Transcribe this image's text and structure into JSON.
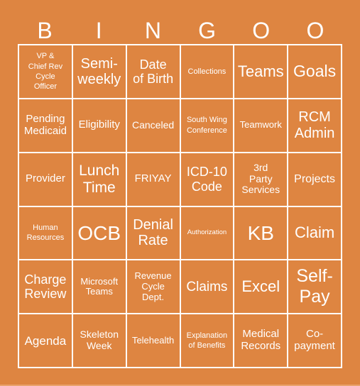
{
  "card": {
    "header_letters": [
      "B",
      "I",
      "N",
      "G",
      "O",
      "O"
    ],
    "colors": {
      "background": "#de8541",
      "grid_lines": "#ffffff",
      "text": "#ffffff"
    },
    "rows": [
      [
        "VP &\nChief Rev\nCycle\nOfficer",
        "Semi-\nweekly",
        "Date\nof Birth",
        "Collections",
        "Teams",
        "Goals"
      ],
      [
        "Pending\nMedicaid",
        "Eligibility",
        "Canceled",
        "South Wing\nConference",
        "Teamwork",
        "RCM\nAdmin"
      ],
      [
        "Provider",
        "Lunch\nTime",
        "FRIYAY",
        "ICD-10\nCode",
        "3rd\nParty\nServices",
        "Projects"
      ],
      [
        "Human\nResources",
        "OCB",
        "Denial\nRate",
        "Authorization",
        "KB",
        "Claim"
      ],
      [
        "Charge\nReview",
        "Microsoft\nTeams",
        "Revenue\nCycle\nDept.",
        "Claims",
        "Excel",
        "Self-\nPay"
      ],
      [
        "Agenda",
        "Skeleton\nWeek",
        "Telehealth",
        "Explanation\nof Benefits",
        "Medical\nRecords",
        "Co-\npayment"
      ]
    ]
  }
}
